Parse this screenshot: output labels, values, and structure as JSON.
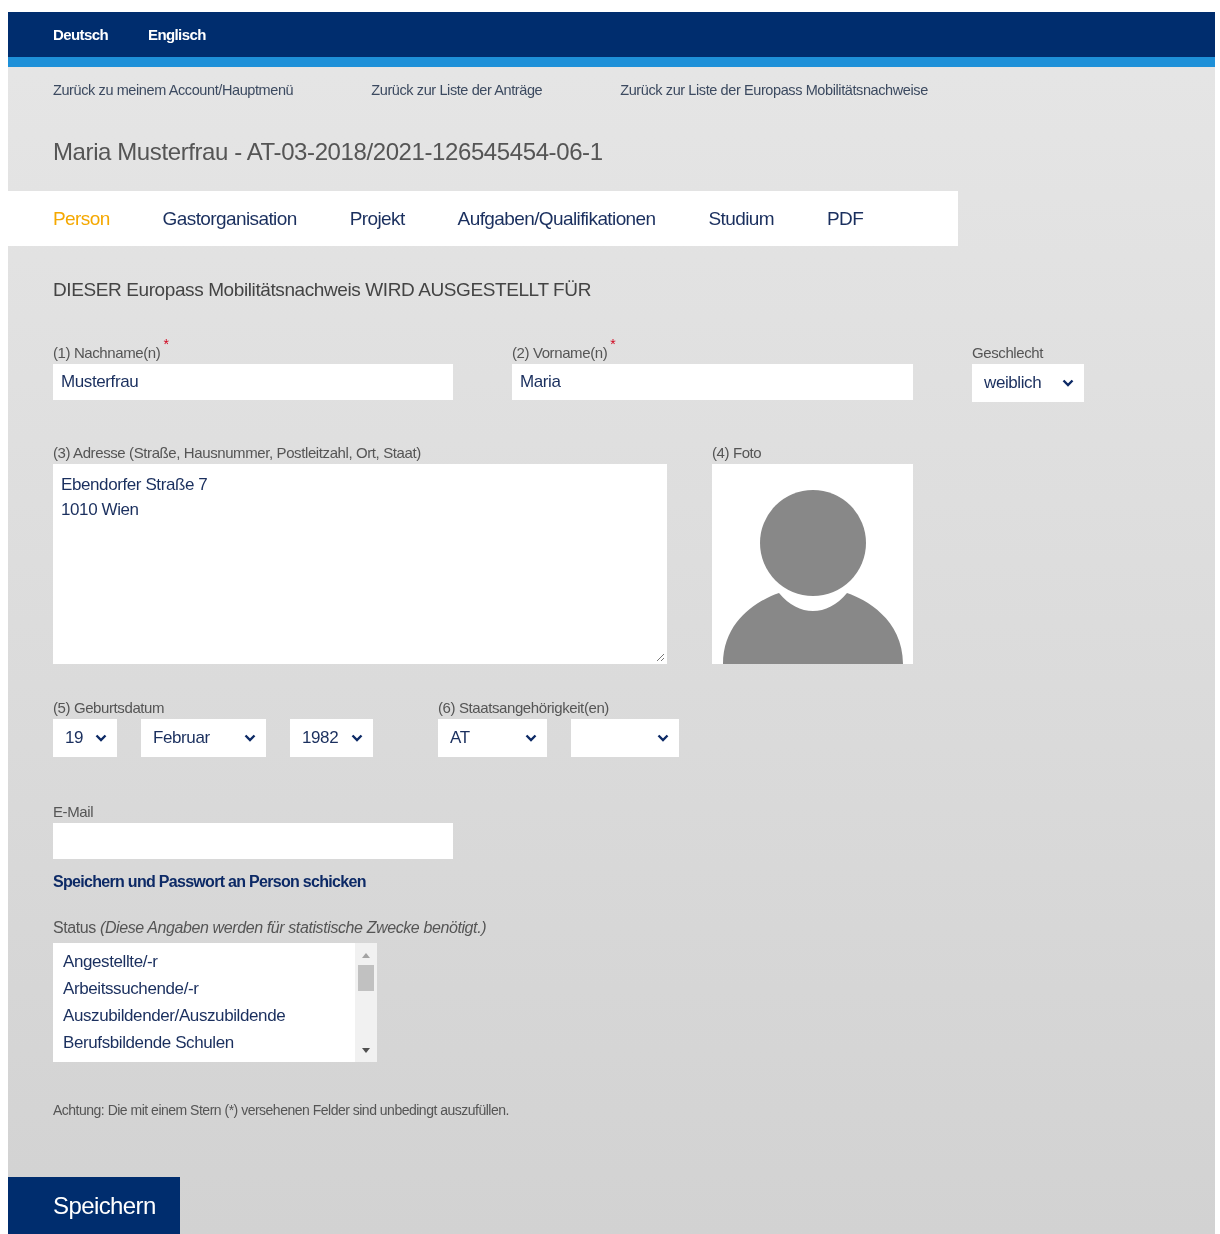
{
  "language_bar": [
    {
      "label": "Deutsch"
    },
    {
      "label": "Englisch"
    }
  ],
  "back_links": [
    "Zurück zu meinem Account/Hauptmenü",
    "Zurück zur Liste der Anträge",
    "Zurück zur Liste der Europass Mobilitätsnachweise"
  ],
  "heading": "Maria Musterfrau - AT-03-2018/2021-126545454-06-1",
  "tabs": [
    {
      "label": "Person",
      "selected": true
    },
    {
      "label": "Gastorganisation",
      "selected": false
    },
    {
      "label": "Projekt",
      "selected": false
    },
    {
      "label": "Aufgaben/Qualifikationen",
      "selected": false
    },
    {
      "label": "Studium",
      "selected": false
    },
    {
      "label": "PDF",
      "selected": false
    }
  ],
  "section_title": "DIESER Europass Mobilitätsnachweis WIRD AUSGESTELLT FÜR",
  "surname": {
    "label": "(1) Nachname(n)",
    "required_mark": "*",
    "value": "Musterfrau"
  },
  "first_name": {
    "label": "(2) Vorname(n)",
    "required_mark": "*",
    "value": "Maria"
  },
  "gender": {
    "label": "Geschlecht",
    "value": "weiblich"
  },
  "address": {
    "label": "(3) Adresse (Straße, Hausnummer, Postleitzahl, Ort, Staat)",
    "value": "Ebendorfer Straße 7\n1010 Wien"
  },
  "photo": {
    "label": "(4) Foto"
  },
  "birth_date": {
    "label": "(5) Geburtsdatum",
    "day": "19",
    "month": "Februar",
    "year": "1982"
  },
  "nationality": {
    "label": "(6) Staatsangehörigkeit(en)",
    "selects": [
      {
        "kind": "filled",
        "value": "AT"
      },
      {
        "kind": "empty"
      }
    ]
  },
  "email": {
    "label": "E-Mail"
  },
  "send_link": "Speichern und Passwort an Person schicken",
  "status": {
    "label": "Status",
    "note": "(Diese Angaben werden für statistische Zwecke benötigt.)",
    "options": [
      "Angestellte/-r",
      "Arbeitssuchende/-r",
      "Auszubildender/Auszubildende",
      "Berufsbildende Schulen"
    ]
  },
  "footnote": "Achtung: Die mit einem Stern (*) versehenen Felder sind unbedingt auszufüllen.",
  "save_button": "Speichern"
}
